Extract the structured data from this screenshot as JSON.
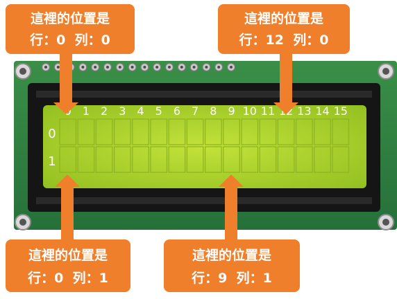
{
  "column_numbers": [
    "0",
    "1",
    "2",
    "3",
    "4",
    "5",
    "6",
    "7",
    "8",
    "9",
    "10",
    "11",
    "12",
    "13",
    "14",
    "15"
  ],
  "row_numbers": [
    "0",
    "1"
  ],
  "callouts": [
    {
      "line1": "這裡的位置是",
      "line2": "行：0  列：0"
    },
    {
      "line1": "這裡的位置是",
      "line2": "行：12  列：0"
    },
    {
      "line1": "這裡的位置是",
      "line2": "行：0  列：1"
    },
    {
      "line1": "這裡的位置是",
      "line2": "行：9  列：1"
    }
  ],
  "colors": {
    "pcb": "#2c7a3c",
    "bezel": "#151515",
    "lcd": "#a8d42a",
    "callout": "#f07f2c"
  }
}
